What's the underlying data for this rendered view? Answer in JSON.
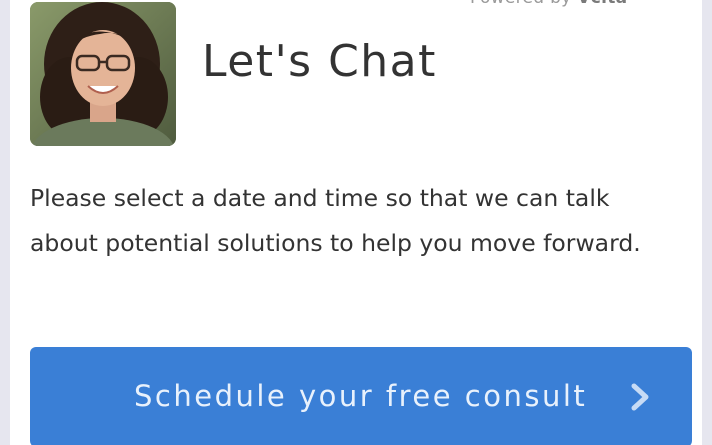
{
  "header": {
    "powered_prefix": "Powered by",
    "powered_brand": "Vcita",
    "menu_icon": "more-dots-icon"
  },
  "profile": {
    "avatar_icon": "profile-photo",
    "title": "Let's Chat"
  },
  "description": "Please select a date and time so that we can talk about potential solutions to help you move forward.",
  "cta": {
    "label": "Schedule your free consult",
    "icon": "chevron-right-icon"
  },
  "colors": {
    "background": "#e6e6ef",
    "card": "#ffffff",
    "accent": "#3a7fd6",
    "text": "#333333"
  }
}
